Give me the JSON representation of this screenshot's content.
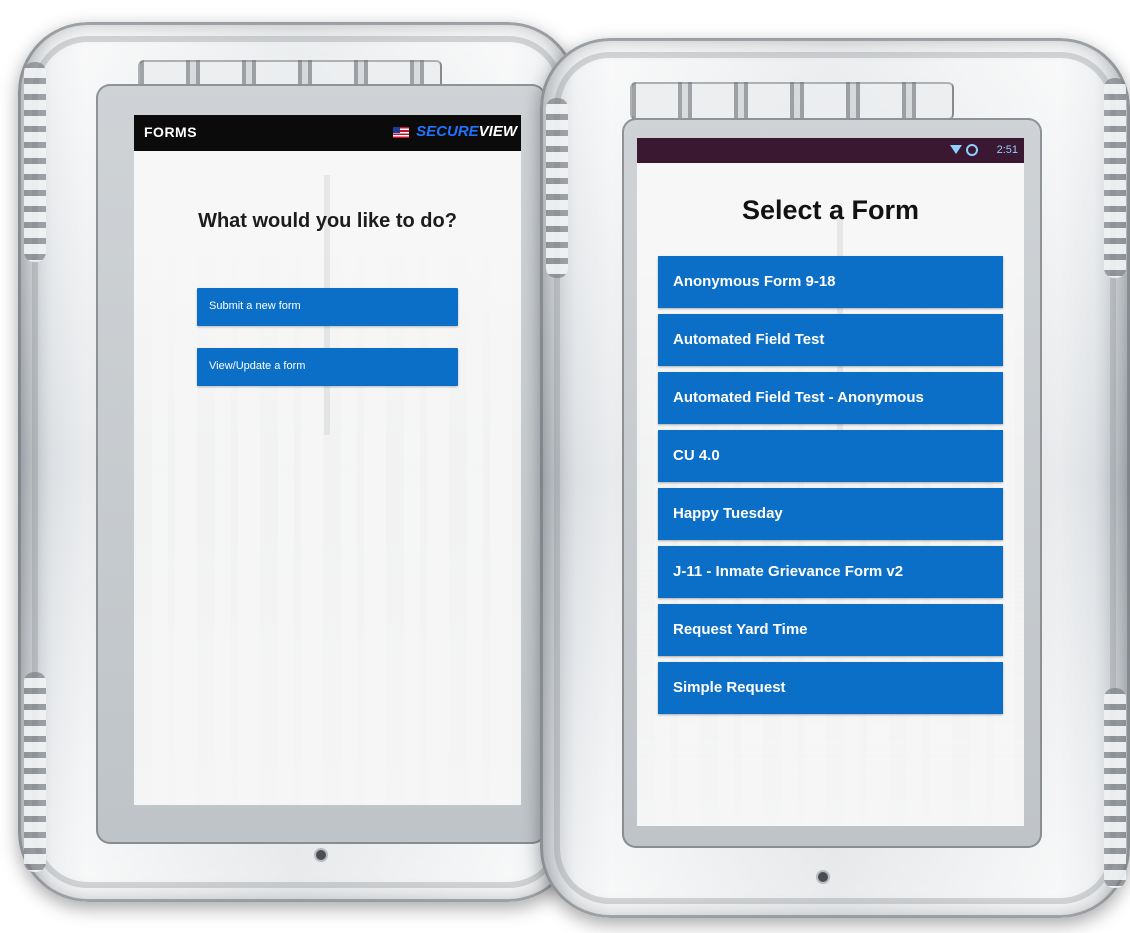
{
  "left_device": {
    "header": {
      "title": "FORMS",
      "brand_part1": "SECURE",
      "brand_part2": "VIEW",
      "flag_icon": "us-flag-icon"
    },
    "prompt": "What would you like to do?",
    "buttons": [
      {
        "label": "Submit a new form"
      },
      {
        "label": "View/Update a form"
      }
    ]
  },
  "right_device": {
    "status_bar": {
      "time": "2:51",
      "wifi_icon": "wifi-icon",
      "sync_icon": "sync-icon",
      "color": "#3b1832"
    },
    "heading": "Select a Form",
    "forms": [
      {
        "label": "Anonymous Form 9-18"
      },
      {
        "label": "Automated Field Test"
      },
      {
        "label": "Automated Field Test - Anonymous"
      },
      {
        "label": "CU 4.0"
      },
      {
        "label": "Happy Tuesday"
      },
      {
        "label": "J-11 - Inmate Grievance Form v2"
      },
      {
        "label": "Request Yard Time"
      },
      {
        "label": "Simple Request"
      }
    ]
  },
  "colors": {
    "accent": "#0b6fc7",
    "brand_blue": "#1e73ff",
    "header_black": "#0b0b0b"
  }
}
